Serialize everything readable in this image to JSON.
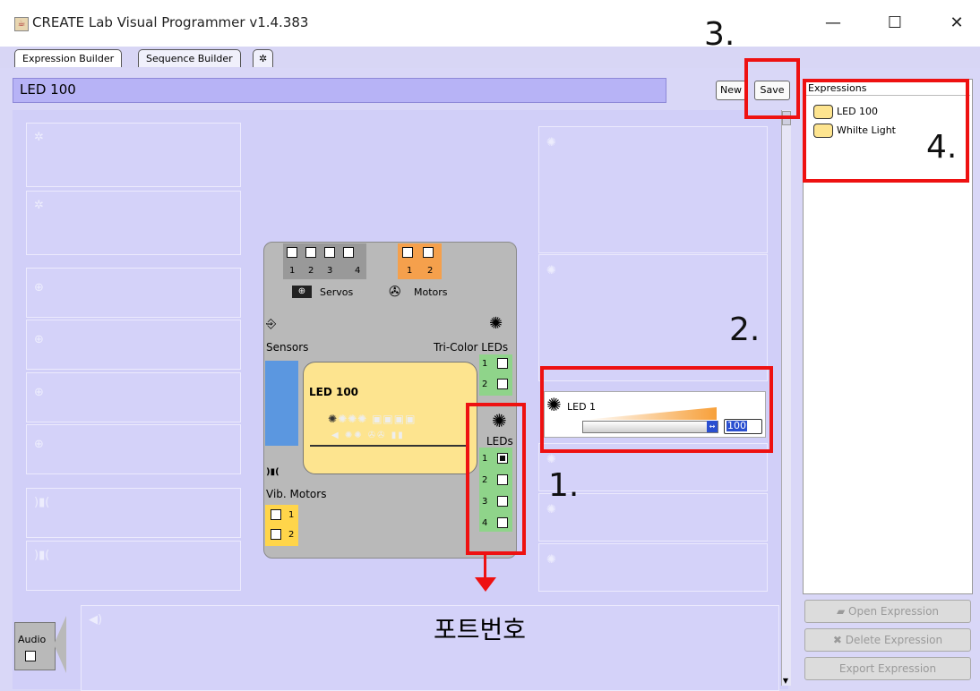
{
  "window": {
    "title": "CREATE Lab Visual Programmer v1.4.383",
    "minimize": "—",
    "maximize": "☐",
    "close": "✕"
  },
  "tabs": [
    {
      "label": "Expression Builder"
    },
    {
      "label": "Sequence Builder"
    },
    {
      "label": "✲"
    }
  ],
  "builder": {
    "expression_name": "LED 100",
    "new_label": "New",
    "save_label": "Save"
  },
  "device": {
    "servos_label": "Servos",
    "motors_label": "Motors",
    "sensors_label": "Sensors",
    "tricolor_label": "Tri-Color LEDs",
    "leds_label": "LEDs",
    "vib_label": "Vib. Motors",
    "servo_ports": [
      "1",
      "2",
      "3",
      "4"
    ],
    "motor_ports": [
      "1",
      "2"
    ],
    "tricolor_ports": [
      "1",
      "2"
    ],
    "led_ports": [
      "1",
      "2",
      "3",
      "4"
    ],
    "vib_ports": [
      "1",
      "2"
    ],
    "card_title": "LED 100"
  },
  "led_panel": {
    "label": "LED 1",
    "value": "100"
  },
  "expressions": {
    "header": "Expressions",
    "items": [
      "LED 100",
      "Whilte Light"
    ],
    "open_label": "Open Expression",
    "delete_label": "Delete Expression",
    "export_label": "Export Expression"
  },
  "audio": {
    "label": "Audio"
  },
  "annotations": {
    "one": "1.",
    "two": "2.",
    "three": "3.",
    "four": "4.",
    "port_caption": "포트번호"
  },
  "colors": {
    "accent_red": "#ee1111",
    "panel_purple": "#d9d7f7",
    "card_yellow": "#fde48f",
    "led_green": "#8fd48a",
    "motor_orange": "#f5a04c",
    "sensor_blue": "#5b97e0"
  }
}
